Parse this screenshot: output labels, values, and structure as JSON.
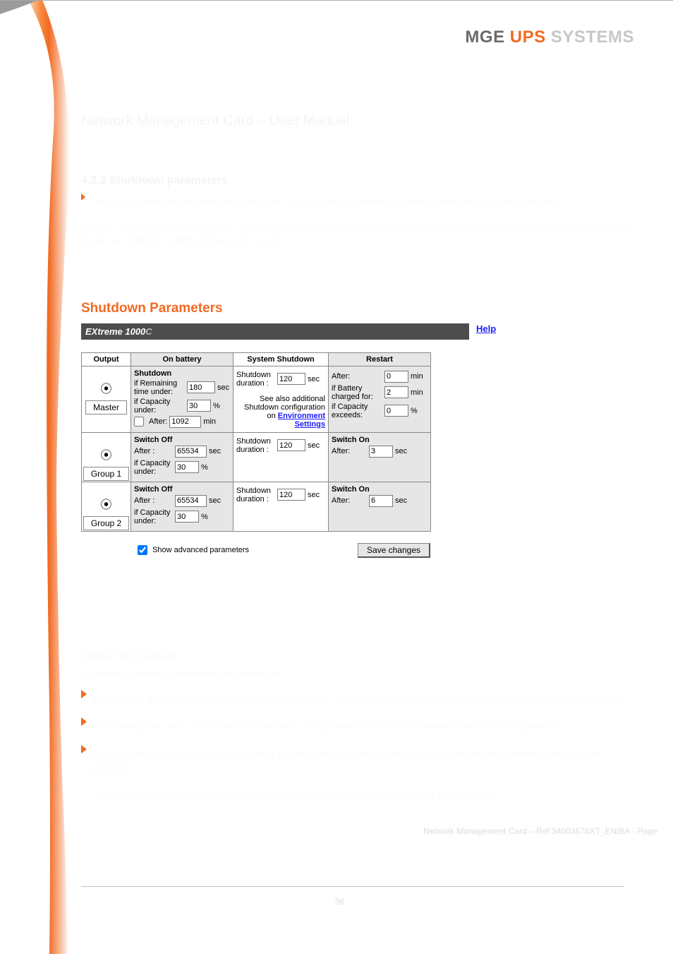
{
  "brand": {
    "mge": "MGE",
    "ups": "UPS",
    "sys": "SYSTEMS"
  },
  "doc_title": "Network Management Card – User Manual",
  "sec432": {
    "heading": "4.3.2 Shutdown parameters",
    "intro": "This page enables viewing and configuration of UPS operating parameters in battery mode and for power restoration.",
    "adv_line": "Click on \"Show advanced parameters\" to display extra parameters for specific shutdown sequence adjustment for the devices powered by the two controlled outlets (Group1 and Group2)."
  },
  "panel_title": "Shutdown Parameters",
  "device_name": "EXtreme 1000",
  "device_suffix": "C",
  "help_label": "Help",
  "headers": {
    "output": "Output",
    "on_battery": "On battery",
    "sys_shutdown": "System Shutdown",
    "restart": "Restart"
  },
  "rows": {
    "master": {
      "out_label": "Master",
      "switch_label": "Shutdown",
      "if_remaining": "if Remaining time under:",
      "if_remaining_val": "180",
      "if_remaining_unit": "sec",
      "if_capacity": "if Capacity under:",
      "if_capacity_val": "30",
      "if_capacity_unit": "%",
      "after_chk_label": "After:",
      "after_val": "1092",
      "after_unit": "min",
      "sd_dur_label": "Shutdown duration :",
      "sd_dur_val": "120",
      "sd_dur_unit": "sec",
      "see_also": "See also additional Shutdown configuration on",
      "env_link": "Environment Settings",
      "restart_after_label": "After:",
      "restart_after_val": "0",
      "restart_after_unit": "min",
      "restart_chg_label": "if Battery charged for:",
      "restart_chg_val": "2",
      "restart_chg_unit": "min",
      "restart_cap_label": "if Capacity exceeds:",
      "restart_cap_val": "0",
      "restart_cap_unit": "%"
    },
    "g1": {
      "out_label": "Group 1",
      "switch_off": "Switch Off",
      "after_label": "After :",
      "after_val": "65534",
      "after_unit": "sec",
      "if_capacity": "if Capacity under:",
      "if_capacity_val": "30",
      "if_capacity_unit": "%",
      "sd_dur_label": "Shutdown duration :",
      "sd_dur_val": "120",
      "sd_dur_unit": "sec",
      "switch_on": "Switch On",
      "on_after_label": "After:",
      "on_after_val": "3",
      "on_after_unit": "sec"
    },
    "g2": {
      "out_label": "Group 2",
      "switch_off": "Switch Off",
      "after_label": "After :",
      "after_val": "65534",
      "after_unit": "sec",
      "if_capacity": "if Capacity under:",
      "if_capacity_val": "30",
      "if_capacity_unit": "%",
      "sd_dur_label": "Shutdown duration :",
      "sd_dur_val": "120",
      "sd_dur_unit": "sec",
      "switch_on": "Switch On",
      "on_after_label": "After:",
      "on_after_val": "6",
      "on_after_unit": "sec"
    }
  },
  "adv_chk_label": "Show advanced parameters",
  "save_label": "Save changes",
  "lower": {
    "output_line": "Output: list of outputs",
    "heading1": "On battery column: parameters for Switch Off",
    "b1_bold": "Main Output (Master): ",
    "b1_text": "Three criteria trigger the shutdown. The first criterion reached causes servers to initiate shutdown procedure.",
    "b2_text": "if Remaining time under: (from 0 to 99999 seconds, 180 by default) Click on the shutdown label to set this parameter.",
    "b3_text": "if Capacity under: (from 0 to 100%); this entry is in the \"show advanced settings\" option. Click on the shutdown label to set this parameter.",
    "b4_text": "After: (from 0 to 99999 seconds, not validated by default). Check the box to validate this parameter."
  },
  "footer": {
    "ref": "Network Management Card – Ref 34003676XT_EN/BA   -       Page",
    "page_no": "36"
  }
}
